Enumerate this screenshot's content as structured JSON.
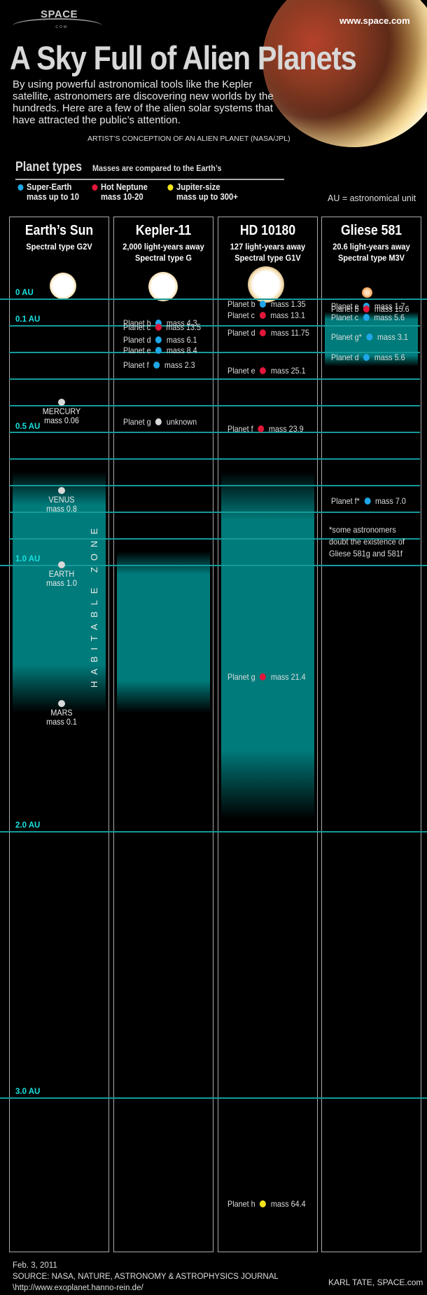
{
  "header": {
    "logo": "SPACE",
    "logo_sub": ".COM",
    "site_url": "www.space.com",
    "title": "A Sky Full of Alien Planets",
    "intro": "By using powerful astronomical tools like the Kepler satellite, astronomers are discovering new worlds by the hundreds. Here are a few of the alien solar systems that have attracted the public’s attention.",
    "image_credit": "ARTIST’S CONCEPTION OF AN ALIEN PLANET (NASA/JPL)"
  },
  "legend": {
    "title": "Planet types",
    "subtitle": "Masses are compared to the Earth’s",
    "items": [
      {
        "name": "Super-Earth",
        "range": "mass up to 10",
        "color": "#1fa7e8"
      },
      {
        "name": "Hot Neptune",
        "range": "mass 10-20",
        "color": "#e0163a"
      },
      {
        "name": "Jupiter-size",
        "range": "mass up to 300+",
        "color": "#f2e21a"
      }
    ],
    "au_note": "AU = astronomical unit"
  },
  "colors": {
    "super_earth": "#1fa7e8",
    "hot_neptune": "#e0163a",
    "jupiter": "#f2e21a",
    "solar": "#d8d8d8",
    "gridline": "#159a9a",
    "au_label": "#19e0e0",
    "habitable": "#007b7b"
  },
  "au_labels": [
    "0 AU",
    "0.1 AU",
    "0.5 AU",
    "1.0 AU",
    "2.0 AU",
    "3.0 AU"
  ],
  "habitable_label": "HABITABLE ZONE",
  "systems": [
    {
      "name": "Earth’s Sun",
      "lines": [
        "Spectral type G2V"
      ],
      "habitable_zone_au": [
        0.7,
        1.5
      ],
      "planets": [
        {
          "name": "MERCURY",
          "mass": "mass 0.06",
          "au": 0.39,
          "type": "solar"
        },
        {
          "name": "VENUS",
          "mass": "mass 0.8",
          "au": 0.72,
          "type": "solar"
        },
        {
          "name": "EARTH",
          "mass": "mass 1.0",
          "au": 1.0,
          "type": "solar"
        },
        {
          "name": "MARS",
          "mass": "mass 0.1",
          "au": 1.52,
          "type": "solar"
        }
      ]
    },
    {
      "name": "Kepler-11",
      "lines": [
        "2,000 light-years away",
        "Spectral type G"
      ],
      "habitable_zone_au": [
        1.0,
        1.5
      ],
      "planets": [
        {
          "name": "Planet b",
          "mass": "mass 4.3",
          "au": 0.091,
          "type": "super_earth"
        },
        {
          "name": "Planet c",
          "mass": "mass 13.5",
          "au": 0.107,
          "type": "hot_neptune"
        },
        {
          "name": "Planet d",
          "mass": "mass 6.1",
          "au": 0.155,
          "type": "super_earth"
        },
        {
          "name": "Planet e",
          "mass": "mass 8.4",
          "au": 0.195,
          "type": "super_earth"
        },
        {
          "name": "Planet f",
          "mass": "mass 2.3",
          "au": 0.25,
          "type": "super_earth"
        },
        {
          "name": "Planet g",
          "mass": "unknown",
          "au": 0.462,
          "type": "solar"
        }
      ]
    },
    {
      "name": "HD 10180",
      "lines": [
        "127 light-years away",
        "Spectral type G1V"
      ],
      "habitable_zone_au": [
        0.7,
        1.9
      ],
      "planets": [
        {
          "name": "Planet b",
          "mass": "mass 1.35",
          "au": 0.022,
          "type": "super_earth"
        },
        {
          "name": "Planet c",
          "mass": "mass 13.1",
          "au": 0.064,
          "type": "hot_neptune"
        },
        {
          "name": "Planet d",
          "mass": "mass 11.75",
          "au": 0.129,
          "type": "hot_neptune"
        },
        {
          "name": "Planet e",
          "mass": "mass 25.1",
          "au": 0.27,
          "type": "hot_neptune"
        },
        {
          "name": "Planet f",
          "mass": "mass 23.9",
          "au": 0.49,
          "type": "hot_neptune"
        },
        {
          "name": "Planet g",
          "mass": "mass 21.4",
          "au": 1.42,
          "type": "hot_neptune"
        },
        {
          "name": "Planet h",
          "mass": "mass 64.4",
          "au": 3.4,
          "type": "jupiter"
        }
      ]
    },
    {
      "name": "Gliese 581",
      "lines": [
        "20.6 light-years away",
        "Spectral type M3V"
      ],
      "habitable_zone_au": [
        0.1,
        0.2
      ],
      "planets": [
        {
          "name": "Planet e",
          "mass": "mass 1.7",
          "au": 0.03,
          "type": "super_earth"
        },
        {
          "name": "Planet b",
          "mass": "mass 15.6",
          "au": 0.04,
          "type": "hot_neptune"
        },
        {
          "name": "Planet c",
          "mass": "mass 5.6",
          "au": 0.07,
          "type": "super_earth"
        },
        {
          "name": "Planet g*",
          "mass": "mass 3.1",
          "au": 0.146,
          "type": "super_earth"
        },
        {
          "name": "Planet d",
          "mass": "mass 5.6",
          "au": 0.22,
          "type": "super_earth"
        },
        {
          "name": "Planet f*",
          "mass": "mass 7.0",
          "au": 0.76,
          "type": "super_earth"
        }
      ],
      "footnote": "*some astronomers doubt the existence of Gliese 581g and 581f"
    }
  ],
  "footer": {
    "date": "Feb. 3, 2011",
    "source": "SOURCE: NASA, NATURE, ASTRONOMY & ASTROPHYSICS JOURNAL",
    "url": "\\http://www.exoplanet.hanno-rein.de/",
    "author": "KARL TATE, SPACE.com"
  }
}
